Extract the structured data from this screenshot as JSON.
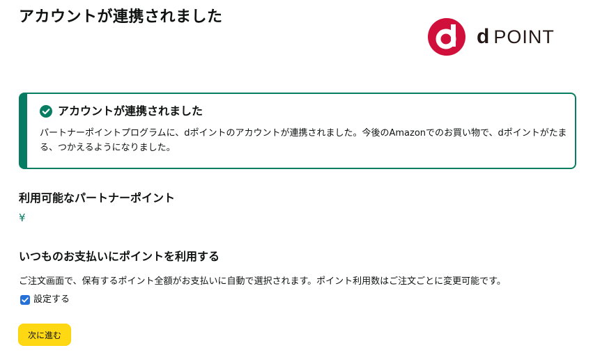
{
  "page": {
    "title": "アカウントが連携されました"
  },
  "logo": {
    "d_letter": "d",
    "point_text": "POINT",
    "brand_color": "#d0103a"
  },
  "alert": {
    "icon": "check-circle-icon",
    "title": "アカウントが連携されました",
    "body": "パートナーポイントプログラムに、dポイントのアカウントが連携されました。今後のAmazonでのお買い物で、dポイントがたまる、つかえるようになりました。",
    "accent_color": "#067d62"
  },
  "available_points": {
    "heading": "利用可能なパートナーポイント",
    "value": "¥"
  },
  "payment": {
    "heading": "いつものお支払いにポイントを利用する",
    "description": "ご注文画面で、保有するポイント全額がお支払いに自動で選択されます。ポイント利用数はご注文ごとに変更可能です。",
    "checkbox_label": "設定する",
    "checkbox_checked": true
  },
  "next_button": {
    "label": "次に進む",
    "color": "#ffd814"
  }
}
